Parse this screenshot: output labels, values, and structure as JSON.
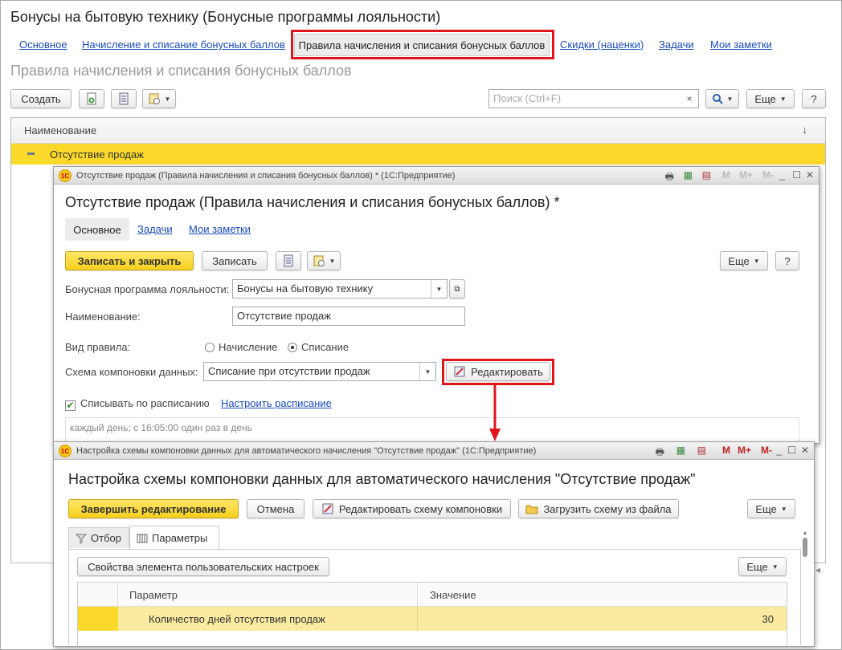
{
  "main": {
    "title": "Бонусы на бытовую технику (Бонусные программы лояльности)",
    "tabs": [
      {
        "label": "Основное"
      },
      {
        "label": "Начисление и списание бонусных баллов"
      },
      {
        "label": "Правила начисления и списания бонусных баллов"
      },
      {
        "label": "Скидки (наценки)"
      },
      {
        "label": "Задачи"
      },
      {
        "label": "Мои заметки"
      }
    ],
    "subtitle": "Правила начисления и списания бонусных баллов",
    "create_label": "Создать",
    "search_placeholder": "Поиск (Ctrl+F)",
    "more_label": "Еще",
    "help_label": "?",
    "list_header": "Наименование",
    "sort_icon": "↓",
    "row_label": "Отсутствие продаж"
  },
  "win1": {
    "title": "Отсутствие продаж (Правила начисления и списания бонусных баллов) * (1С:Предприятие)",
    "heading": "Отсутствие продаж (Правила начисления и списания бонусных баллов) *",
    "tabs": [
      {
        "label": "Основное"
      },
      {
        "label": "Задачи"
      },
      {
        "label": "Мои заметки"
      }
    ],
    "save_close": "Записать и закрыть",
    "save": "Записать",
    "more": "Еще",
    "help": "?",
    "program_label": "Бонусная программа лояльности:",
    "program_value": "Бонусы на бытовую технику",
    "name_label": "Наименование:",
    "name_value": "Отсутствие продаж",
    "rule_label": "Вид правила:",
    "rule_opt1": "Начисление",
    "rule_opt2": "Списание",
    "rule_selected": "Списание",
    "scheme_label": "Схема компоновки данных:",
    "scheme_value": "Списание при отсутствии продаж",
    "edit_btn": "Редактировать",
    "schedule_check": "Списывать по расписанию",
    "schedule_link": "Настроить расписание",
    "schedule_text": "каждый день; с 16:05:00 один раз в день"
  },
  "win2": {
    "title": "Настройка схемы компоновки данных для автоматического начисления \"Отсутствие продаж\" (1С:Предприятие)",
    "heading": "Настройка схемы компоновки данных для автоматического начисления \"Отсутствие продаж\"",
    "finish": "Завершить редактирование",
    "cancel": "Отмена",
    "edit_scheme": "Редактировать схему компоновки",
    "load_scheme": "Загрузить схему из файла",
    "more": "Еще",
    "tab_filter": "Отбор",
    "tab_params": "Параметры",
    "props_btn": "Свойства элемента пользовательских настроек",
    "more2": "Еще",
    "col_param": "Параметр",
    "col_value": "Значение",
    "row_param": "Количество дней отсутствия продаж",
    "row_value": "30"
  },
  "colors": {
    "accent_yellow": "#fad92b",
    "highlight_red": "#e0141c",
    "link_blue": "#1a4bb5"
  }
}
